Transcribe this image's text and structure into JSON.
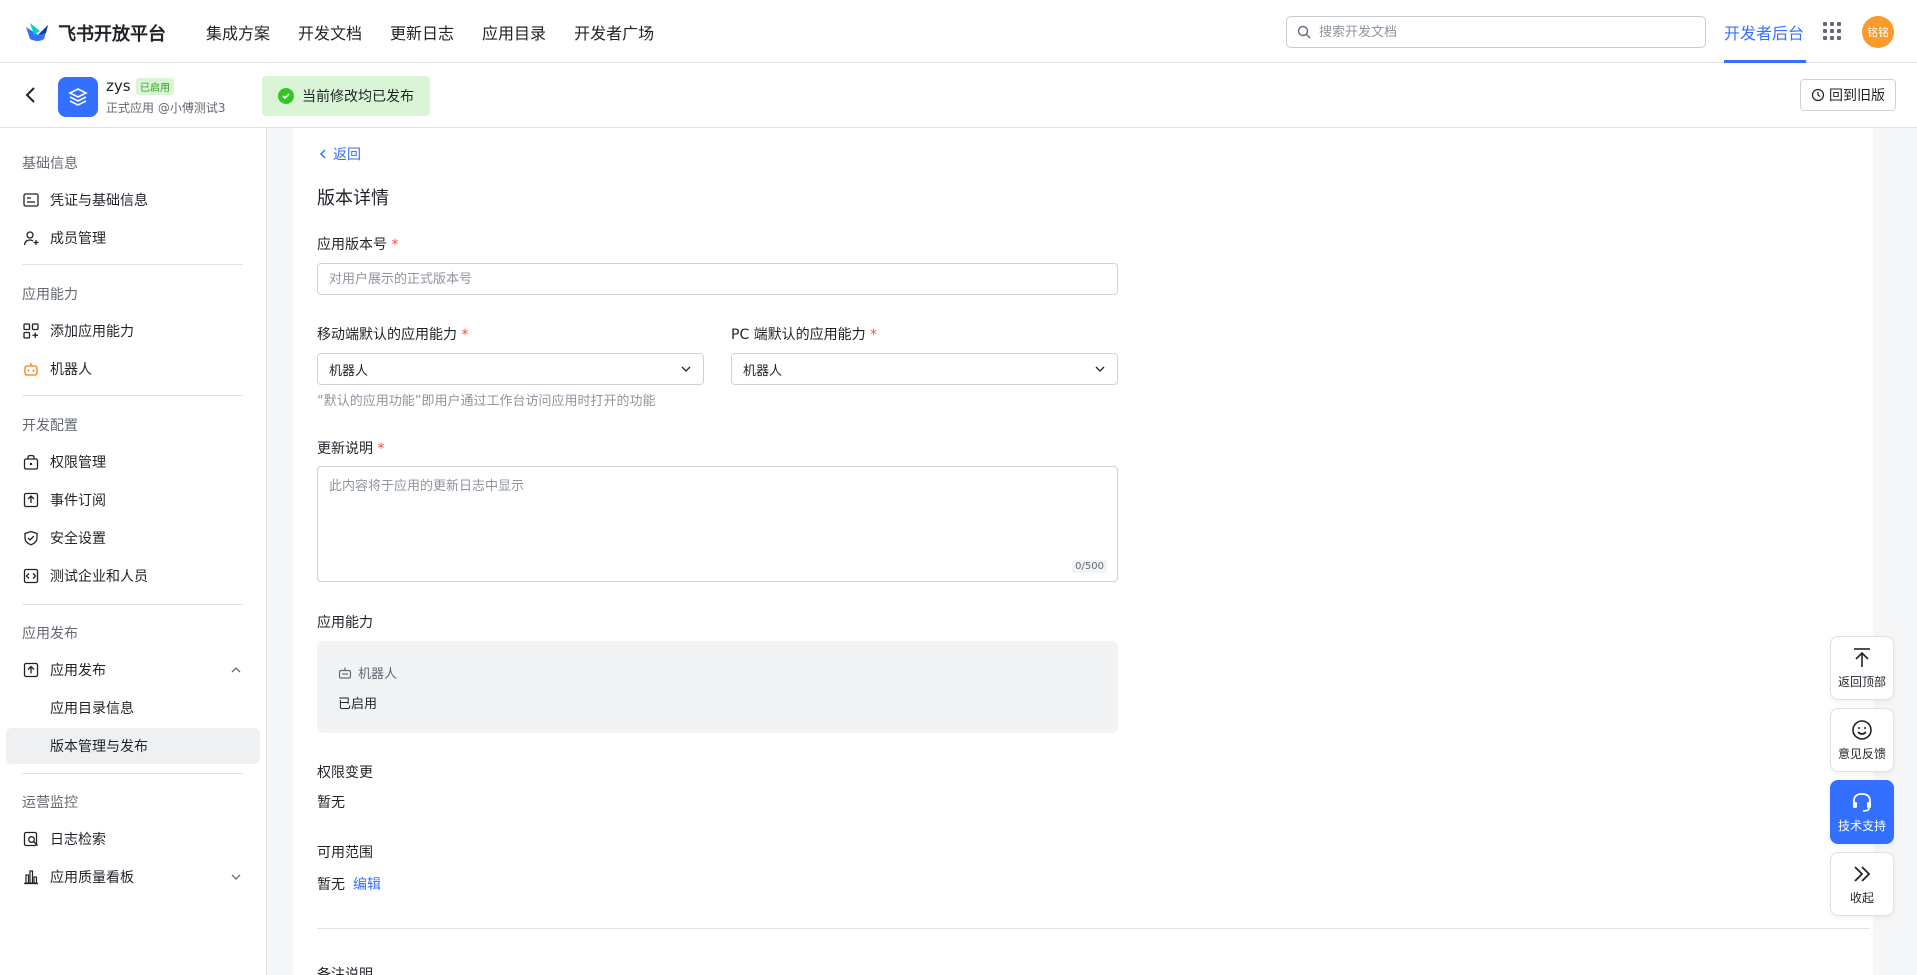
{
  "topbar": {
    "brand": "飞书开放平台",
    "nav": [
      "集成方案",
      "开发文档",
      "更新日志",
      "应用目录",
      "开发者广场"
    ],
    "search_placeholder": "搜索开发文档",
    "dev_console": "开发者后台",
    "avatar_text": "铭铭"
  },
  "appbar": {
    "app_name": "zys",
    "app_badge": "已启用",
    "app_sub": "正式应用 @小傅测试3",
    "toast": "当前修改均已发布",
    "old_version": "回到旧版"
  },
  "sidebar": {
    "group_basic": "基础信息",
    "item_credentials": "凭证与基础信息",
    "item_members": "成员管理",
    "group_ability": "应用能力",
    "item_add_ability": "添加应用能力",
    "item_bot": "机器人",
    "group_dev": "开发配置",
    "item_permission": "权限管理",
    "item_event": "事件订阅",
    "item_security": "安全设置",
    "item_test": "测试企业和人员",
    "group_publish": "应用发布",
    "item_publish": "应用发布",
    "sub_directory": "应用目录信息",
    "sub_version": "版本管理与发布",
    "group_ops": "运营监控",
    "item_logs": "日志检索",
    "item_quality": "应用质量看板"
  },
  "main": {
    "back": "返回",
    "title": "版本详情",
    "version_label": "应用版本号",
    "version_placeholder": "对用户展示的正式版本号",
    "mobile_label": "移动端默认的应用能力",
    "mobile_value": "机器人",
    "pc_label": "PC 端默认的应用能力",
    "pc_value": "机器人",
    "default_hint": "“默认的应用功能”即用户通过工作台访问应用时打开的功能",
    "notes_label": "更新说明",
    "notes_placeholder": "此内容将于应用的更新日志中显示",
    "notes_counter": "0/500",
    "ability_label": "应用能力",
    "ability_name": "机器人",
    "ability_status": "已启用",
    "perm_label": "权限变更",
    "perm_value": "暂无",
    "scope_label": "可用范围",
    "scope_value": "暂无",
    "scope_edit": "编辑",
    "remark_label": "备注说明"
  },
  "float": {
    "top": "返回顶部",
    "feedback": "意见反馈",
    "support": "技术支持",
    "collapse": "收起"
  },
  "colors": {
    "accent": "#3370ff",
    "success": "#34c724",
    "required": "#f54a45"
  }
}
